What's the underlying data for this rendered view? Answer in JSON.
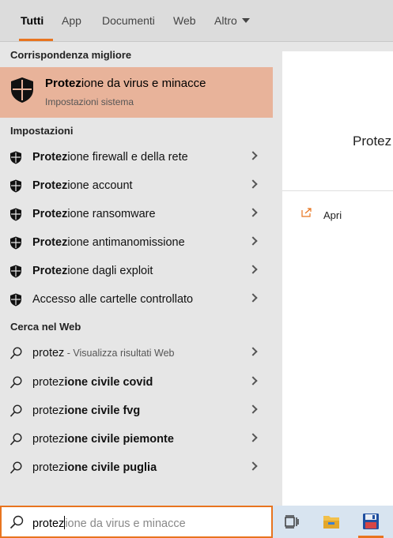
{
  "tabs": [
    {
      "label": "Tutti"
    },
    {
      "label": "App"
    },
    {
      "label": "Documenti"
    },
    {
      "label": "Web"
    },
    {
      "label": "Altro"
    }
  ],
  "best_match": {
    "section_label": "Corrispondenza migliore",
    "title_bold": "Protez",
    "title_rest": "ione da virus e minacce",
    "subtitle": "Impostazioni sistema"
  },
  "settings": {
    "section_label": "Impostazioni",
    "items": [
      {
        "bold": "Protez",
        "rest": "ione firewall e della rete"
      },
      {
        "bold": "Protez",
        "rest": "ione account"
      },
      {
        "bold": "Protez",
        "rest": "ione ransomware"
      },
      {
        "bold": "Protez",
        "rest": "ione antimanomissione"
      },
      {
        "bold": "Protez",
        "rest": "ione dagli exploit"
      },
      {
        "bold": "",
        "rest": "Accesso alle cartelle controllato"
      }
    ]
  },
  "web": {
    "section_label": "Cerca nel Web",
    "first": {
      "query": "protez",
      "hint": " - Visualizza risultati Web"
    },
    "items": [
      {
        "plain": "protez",
        "bold": "ione civile covid"
      },
      {
        "plain": "protez",
        "bold": "ione civile fvg"
      },
      {
        "plain": "protez",
        "bold": "ione civile piemonte"
      },
      {
        "plain": "protez",
        "bold": "ione civile puglia"
      }
    ]
  },
  "preview": {
    "title": "Protez",
    "open_label": "Apri"
  },
  "search": {
    "typed": "protez",
    "suggestion": "ione da virus e minacce"
  },
  "colors": {
    "accent": "#e8741f",
    "best_match_bg": "#e8b39a"
  }
}
